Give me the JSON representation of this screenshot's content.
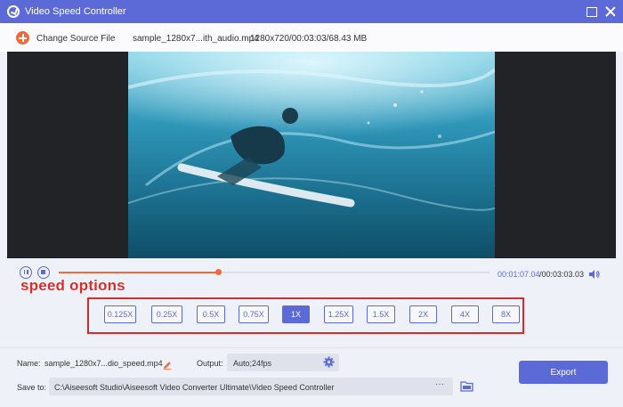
{
  "window": {
    "title": "Video Speed Controller"
  },
  "source": {
    "change_label": "Change Source File",
    "file_name": "sample_1280x7...ith_audio.mp4",
    "file_info": "1280x720/00:03:03/68.43 MB"
  },
  "playback": {
    "current_time": "00:01:07.04",
    "total_time": "/00:03:03.03",
    "progress": 0.37
  },
  "annotation": {
    "label": "speed options"
  },
  "speeds": {
    "options": [
      "0.125X",
      "0.25X",
      "0.5X",
      "0.75X",
      "1X",
      "1.25X",
      "1.5X",
      "2X",
      "4X",
      "8X"
    ],
    "selected": "1X"
  },
  "output_settings": {
    "name_label": "Name:",
    "name_value": "sample_1280x7...dio_speed.mp4",
    "output_label": "Output:",
    "output_value": "Auto;24fps",
    "save_label": "Save to:",
    "save_path": "C:\\Aiseesoft Studio\\Aiseesoft Video Converter Ultimate\\Video Speed Controller",
    "browse_label": "···",
    "export_label": "Export"
  },
  "colors": {
    "accent": "#5c6ad8",
    "progress": "#f06a3e",
    "annotation": "#d72a2a"
  }
}
